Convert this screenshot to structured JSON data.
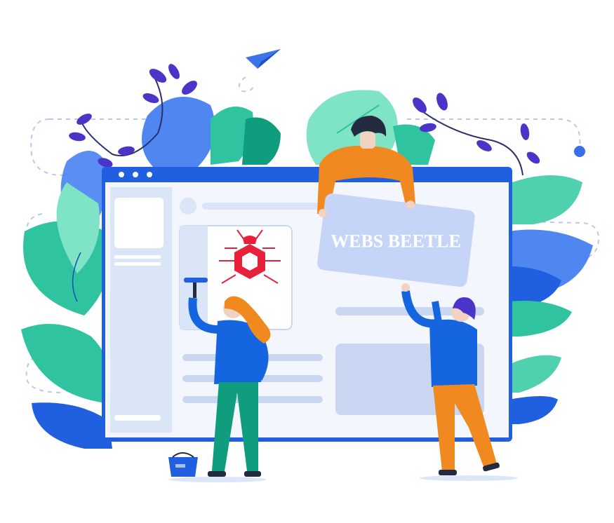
{
  "sign": {
    "label": "WEBS BEETLE"
  },
  "palette": {
    "frame_blue": "#1f5fe0",
    "browser_fill": "#eef2fb",
    "placeholder_blue": "#c9d7f3",
    "leaf_blue": "#4f86f0",
    "leaf_teal": "#2fc3a0",
    "leaf_mint": "#7fe3c6",
    "vine_purple": "#4a35c8",
    "shirt_blue": "#1565e0",
    "shirt_orange": "#f08a20",
    "hair_orange": "#f08a20",
    "hair_dark": "#232b3e",
    "pants_teal": "#0f9d7d",
    "beetle_red": "#e8203a"
  },
  "icons": {
    "paper_plane": "paper-plane-icon",
    "logo": "beetle-logo",
    "bucket": "paint-bucket-icon",
    "squeegee": "squeegee-icon"
  }
}
